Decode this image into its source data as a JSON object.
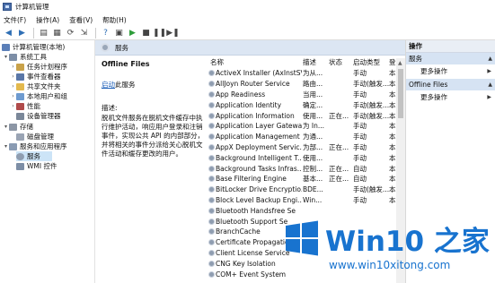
{
  "window": {
    "title": "计算机管理"
  },
  "menu": [
    "文件(F)",
    "操作(A)",
    "查看(V)",
    "帮助(H)"
  ],
  "tree": {
    "root": "计算机管理(本地)",
    "items": [
      {
        "label": "系统工具",
        "level": 1,
        "expanded": true
      },
      {
        "label": "任务计划程序",
        "level": 2
      },
      {
        "label": "事件查看器",
        "level": 2
      },
      {
        "label": "共享文件夹",
        "level": 2
      },
      {
        "label": "本地用户和组",
        "level": 2
      },
      {
        "label": "性能",
        "level": 2
      },
      {
        "label": "设备管理器",
        "level": 2
      },
      {
        "label": "存储",
        "level": 1,
        "expanded": true
      },
      {
        "label": "磁盘管理",
        "level": 2
      },
      {
        "label": "服务和应用程序",
        "level": 1,
        "expanded": true
      },
      {
        "label": "服务",
        "level": 2,
        "selected": true
      },
      {
        "label": "WMI 控件",
        "level": 2
      }
    ]
  },
  "services_panel": {
    "header": "服务",
    "detail_title": "Offline Files",
    "start_link": "启动",
    "start_suffix": "此服务",
    "desc_label": "描述:",
    "description": "脱机文件服务在脱机文件缓存中执行维护活动，响应用户登录和注销事件，实现公共 API 的内部部分，并将相关的事件分派给关心脱机文件活动和缓存更改的用户。"
  },
  "table": {
    "columns": [
      "名称",
      "描述",
      "状态",
      "启动类型",
      "登"
    ],
    "rows": [
      [
        "ActiveX Installer (AxInstSV)",
        "为从...",
        "",
        "手动",
        "本"
      ],
      [
        "AllJoyn Router Service",
        "路由...",
        "",
        "手动(触发...",
        "本"
      ],
      [
        "App Readiness",
        "当用...",
        "",
        "手动",
        "本"
      ],
      [
        "Application Identity",
        "确定...",
        "",
        "手动(触发...",
        "本"
      ],
      [
        "Application Information",
        "使用...",
        "正在...",
        "手动(触发...",
        "本"
      ],
      [
        "Application Layer Gatewa...",
        "为 In...",
        "",
        "手动",
        "本"
      ],
      [
        "Application Management",
        "为通...",
        "",
        "手动",
        "本"
      ],
      [
        "AppX Deployment Servic...",
        "为部...",
        "正在...",
        "手动",
        "本"
      ],
      [
        "Background Intelligent T...",
        "使用...",
        "",
        "手动",
        "本"
      ],
      [
        "Background Tasks Infras...",
        "控制...",
        "正在...",
        "自动",
        "本"
      ],
      [
        "Base Filtering Engine",
        "基本...",
        "正在...",
        "自动",
        "本"
      ],
      [
        "BitLocker Drive Encryptio...",
        "BDE...",
        "",
        "手动(触发...",
        "本"
      ],
      [
        "Block Level Backup Engi...",
        "Win...",
        "",
        "手动",
        "本"
      ],
      [
        "Bluetooth Handsfree Se",
        "",
        "",
        "",
        ""
      ],
      [
        "Bluetooth Support Se",
        "",
        "",
        "",
        ""
      ],
      [
        "BranchCache",
        "",
        "",
        "",
        ""
      ],
      [
        "Certificate Propagatio",
        "",
        "",
        "",
        ""
      ],
      [
        "Client License Service",
        "",
        "",
        "",
        ""
      ],
      [
        "CNG Key Isolation",
        "",
        "",
        "",
        ""
      ],
      [
        "COM+ Event System",
        "",
        "",
        "",
        ""
      ]
    ]
  },
  "actions": {
    "header": "操作",
    "sections": [
      {
        "title": "服务",
        "items": [
          "更多操作"
        ]
      },
      {
        "title": "Offline Files",
        "items": [
          "更多操作"
        ]
      }
    ]
  },
  "watermark": {
    "title": "Win10 之家",
    "url": "www.win10xitong.com"
  }
}
